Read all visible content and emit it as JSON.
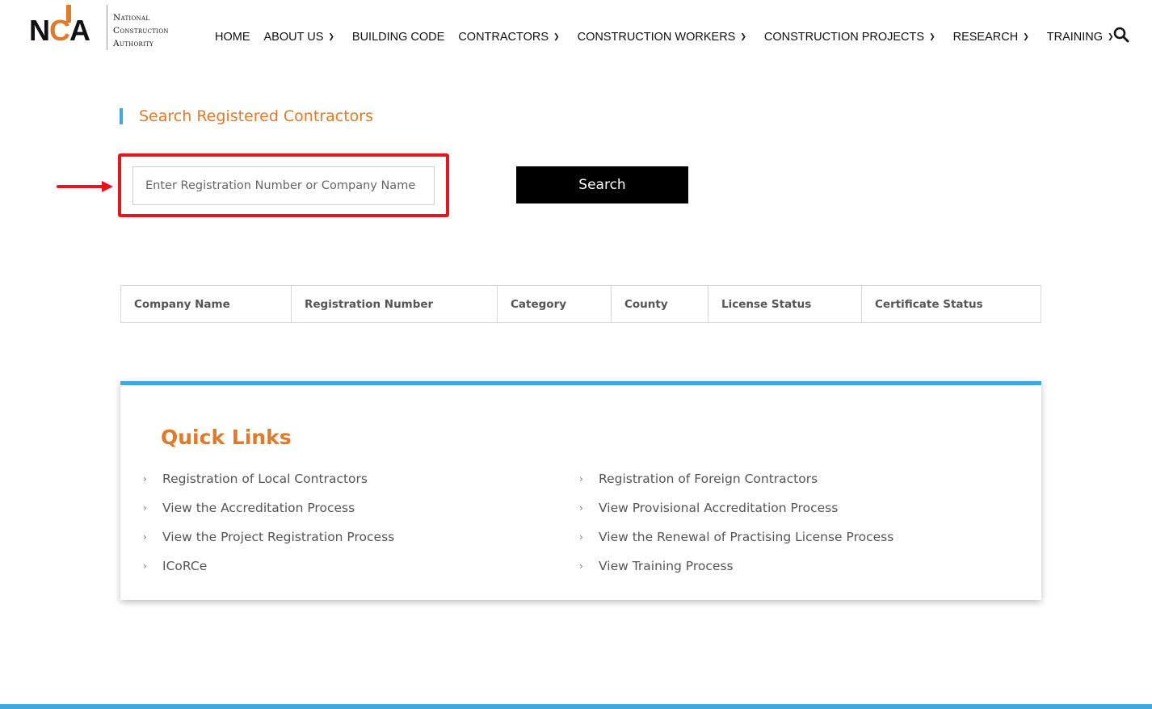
{
  "logo": {
    "mark_n": "N",
    "mark_c": "C",
    "mark_a": "A",
    "line1": "National",
    "line2": "Construction",
    "line3": "Authority"
  },
  "nav": {
    "items": [
      {
        "label": "HOME",
        "dropdown": false
      },
      {
        "label": "ABOUT US",
        "dropdown": true
      },
      {
        "label": "BUILDING CODE",
        "dropdown": false
      },
      {
        "label": "CONTRACTORS",
        "dropdown": true
      },
      {
        "label": "CONSTRUCTION WORKERS",
        "dropdown": true
      },
      {
        "label": "CONSTRUCTION PROJECTS",
        "dropdown": true
      },
      {
        "label": "RESEARCH",
        "dropdown": true
      },
      {
        "label": "TRAINING",
        "dropdown": true
      }
    ],
    "search_icon": "search-icon"
  },
  "section": {
    "title": "Search Registered Contractors"
  },
  "search": {
    "placeholder": "Enter Registration Number or Company Name",
    "value": "",
    "button_label": "Search"
  },
  "table": {
    "headers": [
      "Company Name",
      "Registration Number",
      "Category",
      "County",
      "License Status",
      "Certificate Status"
    ]
  },
  "quick_links": {
    "title": "Quick Links",
    "left": [
      "Registration of Local Contractors",
      "View the Accreditation Process",
      "View the Project Registration Process",
      "ICoRCe"
    ],
    "right": [
      "Registration of Foreign Contractors",
      "View Provisional Accreditation Process",
      "View the Renewal of Practising License Process",
      "View Training Process"
    ]
  },
  "colors": {
    "accent_orange": "#e07a2c",
    "accent_blue": "#3ea8e5",
    "highlight_red": "#e8141c",
    "button_black": "#000000"
  }
}
